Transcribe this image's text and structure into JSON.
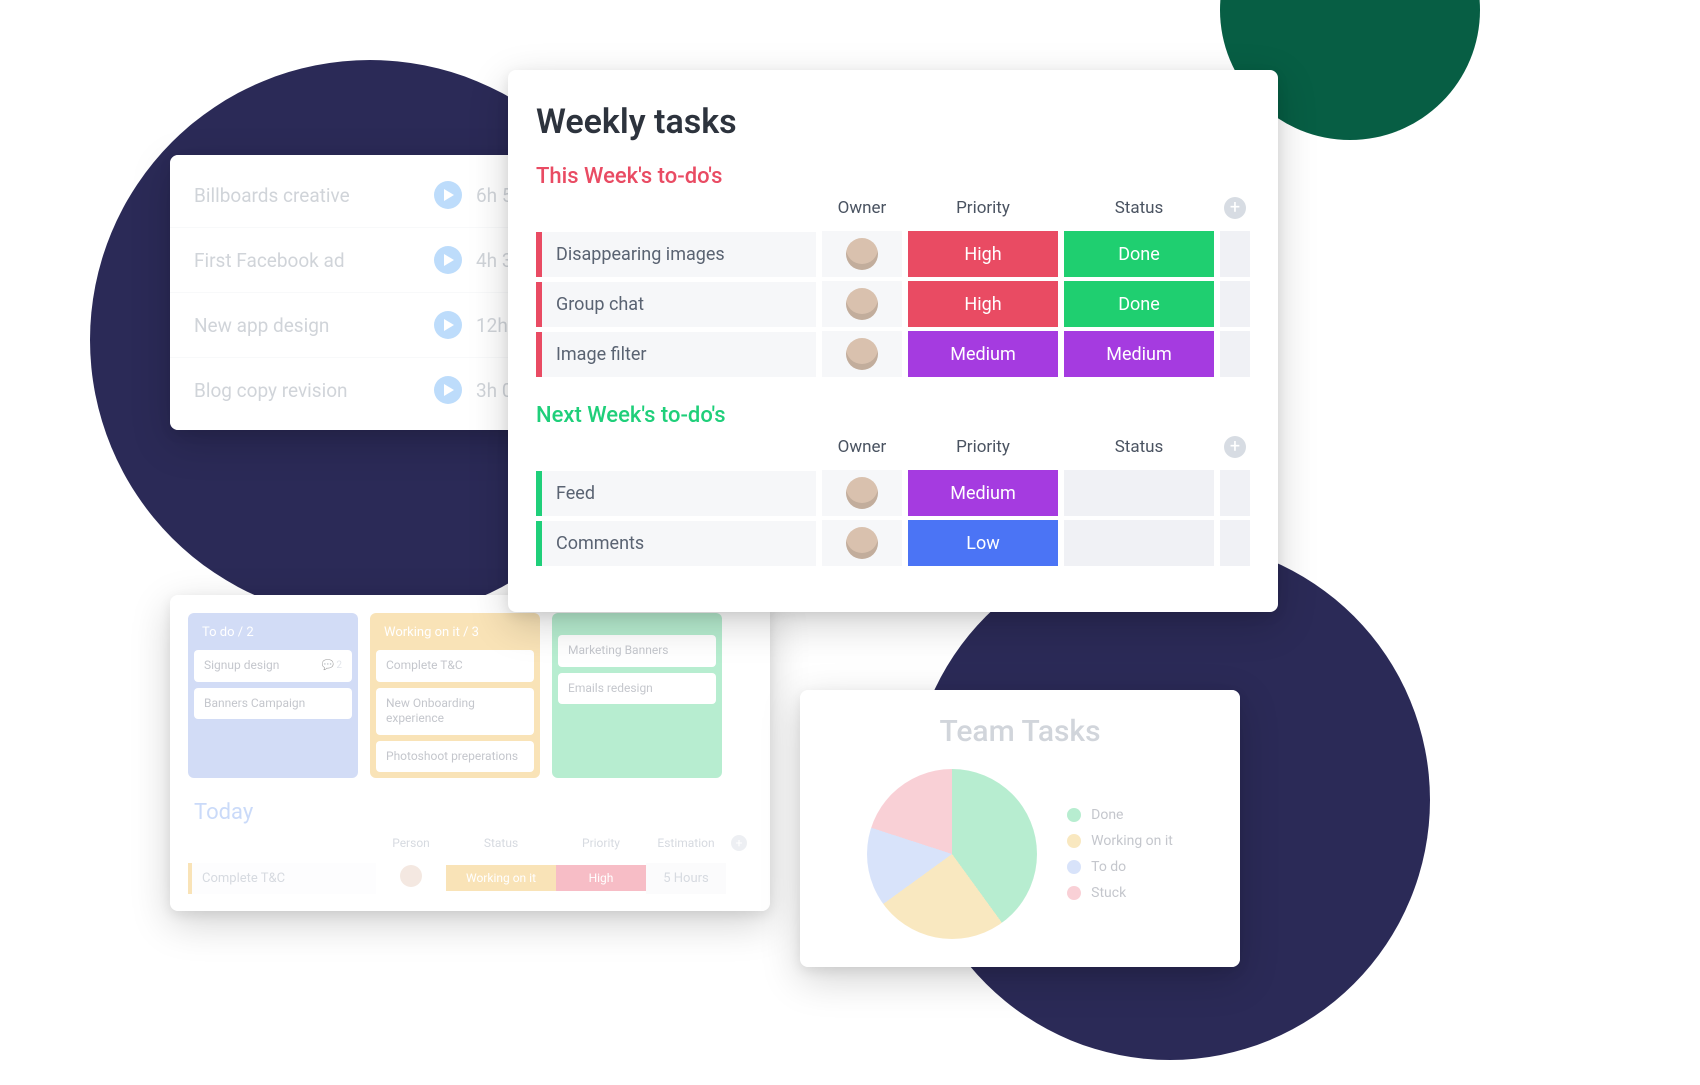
{
  "colors": {
    "red": "#e94b63",
    "green": "#1fcf70",
    "purple": "#a53be0",
    "blue": "#4b74f5",
    "yellow": "#f0b84d",
    "softblue": "#8fa7e8"
  },
  "time_card": {
    "rows": [
      {
        "name": "Billboards creative",
        "duration": "6h 5"
      },
      {
        "name": "First Facebook ad",
        "duration": "4h 3"
      },
      {
        "name": "New app design",
        "duration": "12h"
      },
      {
        "name": "Blog copy revision",
        "duration": "3h 0"
      }
    ]
  },
  "kanban_card": {
    "columns": [
      {
        "title": "To do / 2",
        "color": "blue",
        "cards": [
          {
            "text": "Signup design",
            "comments": 2
          },
          {
            "text": "Banners Campaign"
          }
        ]
      },
      {
        "title": "Working on it / 3",
        "color": "yellow",
        "cards": [
          {
            "text": "Complete T&C"
          },
          {
            "text": "New Onboarding experience"
          },
          {
            "text": "Photoshoot preperations"
          }
        ]
      },
      {
        "title": "",
        "color": "green",
        "cards": [
          {
            "text": "Marketing Banners"
          },
          {
            "text": "Emails redesign"
          }
        ]
      }
    ],
    "today": {
      "title": "Today",
      "headers": [
        "",
        "Person",
        "Status",
        "Priority",
        "Estimation",
        "+"
      ],
      "row": {
        "name": "Complete T&C",
        "status": "Working on it",
        "priority": "High",
        "estimation": "5 Hours"
      }
    }
  },
  "pie_card": {
    "title": "Team Tasks",
    "legend": [
      {
        "label": "Done",
        "color": "#4dd28a"
      },
      {
        "label": "Working on it",
        "color": "#f0c661"
      },
      {
        "label": "To do",
        "color": "#9fb8f2"
      },
      {
        "label": "Stuck",
        "color": "#f08a9a"
      }
    ]
  },
  "chart_data": {
    "type": "pie",
    "title": "Team Tasks",
    "series": [
      {
        "name": "Done",
        "value": 40,
        "color": "#4dd28a"
      },
      {
        "name": "Working on it",
        "value": 25,
        "color": "#f0c661"
      },
      {
        "name": "To do",
        "value": 15,
        "color": "#9fb8f2"
      },
      {
        "name": "Stuck",
        "value": 20,
        "color": "#f08a9a"
      }
    ]
  },
  "weekly": {
    "title": "Weekly tasks",
    "columns": [
      "Owner",
      "Priority",
      "Status"
    ],
    "groups": [
      {
        "title": "This Week's to-do's",
        "accent": "red",
        "rows": [
          {
            "name": "Disappearing images",
            "priority": {
              "label": "High",
              "color": "red"
            },
            "status": {
              "label": "Done",
              "color": "green"
            }
          },
          {
            "name": "Group chat",
            "priority": {
              "label": "High",
              "color": "red"
            },
            "status": {
              "label": "Done",
              "color": "green"
            }
          },
          {
            "name": "Image filter",
            "priority": {
              "label": "Medium",
              "color": "purple"
            },
            "status": {
              "label": "Medium",
              "color": "purple"
            }
          }
        ]
      },
      {
        "title": "Next Week's to-do's",
        "accent": "green",
        "rows": [
          {
            "name": "Feed",
            "priority": {
              "label": "Medium",
              "color": "purple"
            },
            "status": null
          },
          {
            "name": "Comments",
            "priority": {
              "label": "Low",
              "color": "blue"
            },
            "status": null
          }
        ]
      }
    ]
  }
}
